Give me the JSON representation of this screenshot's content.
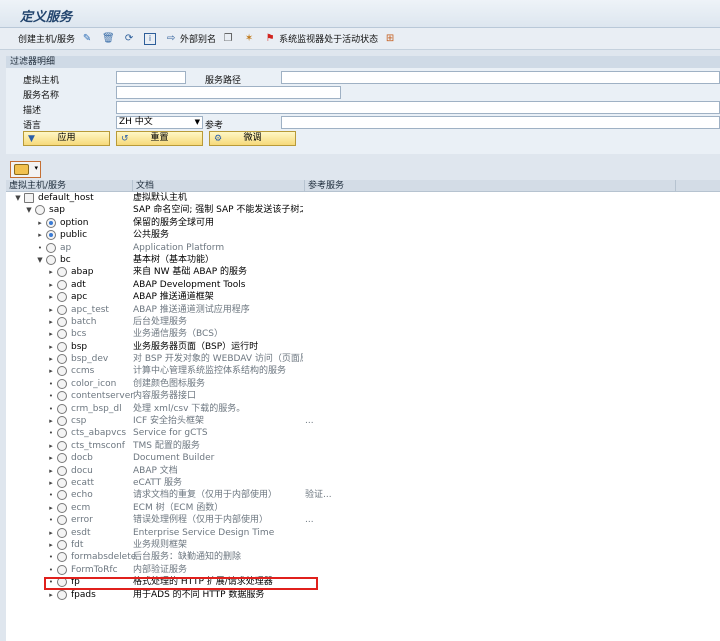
{
  "page_title": "定义服务",
  "toolbar": {
    "create_host": "创建主机/服务",
    "external_alias": "外部别名",
    "monitor_label": "系统监视器处于活动状态"
  },
  "filter": {
    "header": "过滤器明细",
    "virtual_host_label": "虚拟主机",
    "service_path_label": "服务路径",
    "service_name_label": "服务名称",
    "description_label": "描述",
    "language_label": "语言",
    "language_value": "ZH 中文",
    "reference_label": "参考",
    "apply_button": "应用",
    "reset_button": "重置",
    "tune_button": "微调"
  },
  "table": {
    "columns": [
      "虚拟主机/服务",
      "文档",
      "参考服务"
    ],
    "rows": [
      {
        "name": "default_host",
        "doc": "虚拟默认主机",
        "ref": "",
        "level": 0,
        "toggle": "▼",
        "icon": "page",
        "state": "active"
      },
      {
        "name": "sap",
        "doc": "SAP 命名空间; 强制 SAP 不能发送该子树之...",
        "ref": "",
        "level": 1,
        "toggle": "▼",
        "icon": "circle",
        "state": "active"
      },
      {
        "name": "option",
        "doc": "保留的服务全球可用",
        "ref": "",
        "level": 2,
        "toggle": "▸",
        "icon": "active",
        "state": "active"
      },
      {
        "name": "public",
        "doc": "公共服务",
        "ref": "",
        "level": 2,
        "toggle": "▸",
        "icon": "active",
        "state": "active"
      },
      {
        "name": "ap",
        "doc": "Application Platform",
        "ref": "",
        "level": 2,
        "toggle": "•",
        "icon": "circle",
        "state": "inactive"
      },
      {
        "name": "bc",
        "doc": "基本树（基本功能）",
        "ref": "",
        "level": 2,
        "toggle": "▼",
        "icon": "circle",
        "state": "active"
      },
      {
        "name": "abap",
        "doc": "来自 NW 基础 ABAP 的服务",
        "ref": "",
        "level": 3,
        "toggle": "▸",
        "icon": "circle",
        "state": "active"
      },
      {
        "name": "adt",
        "doc": "ABAP Development Tools",
        "ref": "",
        "level": 3,
        "toggle": "▸",
        "icon": "circle",
        "state": "active"
      },
      {
        "name": "apc",
        "doc": "ABAP 推送通道框架",
        "ref": "",
        "level": 3,
        "toggle": "▸",
        "icon": "circle",
        "state": "active"
      },
      {
        "name": "apc_test",
        "doc": "ABAP 推送通道测试应用程序",
        "ref": "",
        "level": 3,
        "toggle": "▸",
        "icon": "circle",
        "state": "inactive"
      },
      {
        "name": "batch",
        "doc": "后台处理服务",
        "ref": "",
        "level": 3,
        "toggle": "▸",
        "icon": "circle",
        "state": "inactive"
      },
      {
        "name": "bcs",
        "doc": "业务通信服务（BCS）",
        "ref": "",
        "level": 3,
        "toggle": "▸",
        "icon": "circle",
        "state": "inactive"
      },
      {
        "name": "bsp",
        "doc": "业务服务器页面（BSP）运行时",
        "ref": "",
        "level": 3,
        "toggle": "▸",
        "icon": "circle",
        "state": "active"
      },
      {
        "name": "bsp_dev",
        "doc": "对 BSP 开发对象的 WEBDAV 访问（页面原...",
        "ref": "",
        "level": 3,
        "toggle": "▸",
        "icon": "circle",
        "state": "inactive"
      },
      {
        "name": "ccms",
        "doc": "计算中心管理系统监控体系结构的服务",
        "ref": "",
        "level": 3,
        "toggle": "▸",
        "icon": "circle",
        "state": "inactive"
      },
      {
        "name": "color_icon",
        "doc": "创建颜色图标服务",
        "ref": "",
        "level": 3,
        "toggle": "•",
        "icon": "circle",
        "state": "inactive"
      },
      {
        "name": "contentserver",
        "doc": "内容服务器接口",
        "ref": "",
        "level": 3,
        "toggle": "•",
        "icon": "circle",
        "state": "inactive"
      },
      {
        "name": "crm_bsp_dl",
        "doc": "处理 xml/csv 下载的服务。",
        "ref": "",
        "level": 3,
        "toggle": "•",
        "icon": "circle",
        "state": "inactive"
      },
      {
        "name": "csp",
        "doc": "ICF 安全抬头框架",
        "ref": "...",
        "level": 3,
        "toggle": "▸",
        "icon": "circle",
        "state": "inactive"
      },
      {
        "name": "cts_abapvcs",
        "doc": "Service for gCTS",
        "ref": "",
        "level": 3,
        "toggle": "•",
        "icon": "circle",
        "state": "inactive"
      },
      {
        "name": "cts_tmsconf",
        "doc": "TMS 配置的服务",
        "ref": "",
        "level": 3,
        "toggle": "▸",
        "icon": "circle",
        "state": "inactive"
      },
      {
        "name": "docb",
        "doc": "Document Builder",
        "ref": "",
        "level": 3,
        "toggle": "▸",
        "icon": "circle",
        "state": "inactive"
      },
      {
        "name": "docu",
        "doc": "ABAP 文档",
        "ref": "",
        "level": 3,
        "toggle": "▸",
        "icon": "circle",
        "state": "inactive"
      },
      {
        "name": "ecatt",
        "doc": "eCATT 服务",
        "ref": "",
        "level": 3,
        "toggle": "▸",
        "icon": "circle",
        "state": "inactive"
      },
      {
        "name": "echo",
        "doc": "请求文档的重复（仅用于内部使用）",
        "ref": "验证...",
        "level": 3,
        "toggle": "•",
        "icon": "circle",
        "state": "inactive"
      },
      {
        "name": "ecm",
        "doc": "ECM 树（ECM 函数）",
        "ref": "",
        "level": 3,
        "toggle": "▸",
        "icon": "circle",
        "state": "inactive"
      },
      {
        "name": "error",
        "doc": "错误处理例程（仅用于内部使用）",
        "ref": "...",
        "level": 3,
        "toggle": "•",
        "icon": "circle",
        "state": "inactive"
      },
      {
        "name": "esdt",
        "doc": "Enterprise Service Design Time",
        "ref": "",
        "level": 3,
        "toggle": "▸",
        "icon": "circle",
        "state": "inactive"
      },
      {
        "name": "fdt",
        "doc": "业务规则框架",
        "ref": "",
        "level": 3,
        "toggle": "▸",
        "icon": "circle",
        "state": "inactive"
      },
      {
        "name": "formabsdelete",
        "doc": "后台服务：缺勤通知的删除",
        "ref": "",
        "level": 3,
        "toggle": "•",
        "icon": "circle",
        "state": "inactive"
      },
      {
        "name": "FormToRfc",
        "doc": "内部验证服务",
        "ref": "",
        "level": 3,
        "toggle": "•",
        "icon": "circle",
        "state": "inactive"
      },
      {
        "name": "fp",
        "doc": "格式处理的 HTTP 扩展/请求处理器",
        "ref": "",
        "level": 3,
        "toggle": "•",
        "icon": "circle",
        "state": "active"
      },
      {
        "name": "fpads",
        "doc": "用于ADS 的不同 HTTP 数据服务",
        "ref": "",
        "level": 3,
        "toggle": "▸",
        "icon": "circle",
        "state": "active"
      }
    ]
  }
}
